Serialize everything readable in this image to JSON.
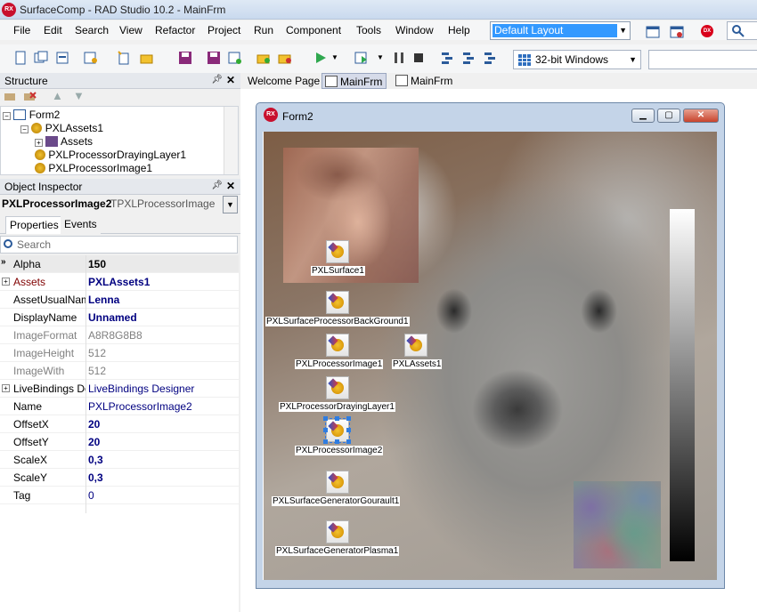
{
  "window": {
    "title": "SurfaceComp - RAD Studio 10.2 - MainFrm",
    "app_icon": "RX"
  },
  "menu": [
    "File",
    "Edit",
    "Search",
    "View",
    "Refactor",
    "Project",
    "Run",
    "Component",
    "Tools",
    "Window",
    "Help"
  ],
  "layout_combo": {
    "value": "Default Layout"
  },
  "platform_combo": {
    "value": "32-bit Windows"
  },
  "dx_badge": "DX",
  "structure": {
    "title": "Structure",
    "tree": [
      {
        "label": "Form2"
      },
      {
        "label": "PXLAssets1"
      },
      {
        "label": "Assets"
      },
      {
        "label": "PXLProcessorDrayingLayer1"
      },
      {
        "label": "PXLProcessorImage1"
      }
    ]
  },
  "object_inspector": {
    "title": "Object Inspector",
    "component_name": "PXLProcessorImage2",
    "component_type": "TPXLProcessorImage",
    "tabs": [
      "Properties",
      "Events"
    ],
    "search_placeholder": "Search",
    "properties": [
      {
        "name": "Alpha",
        "value": "150",
        "name_color": "#000000",
        "value_color": "#000000",
        "bold": true,
        "selected": true,
        "expander": ""
      },
      {
        "name": "Assets",
        "value": "PXLAssets1",
        "name_color": "#800000",
        "value_color": "#000080",
        "bold": true,
        "selected": false,
        "expander": "+"
      },
      {
        "name": "AssetUsualName",
        "value": "Lenna",
        "name_color": "#000000",
        "value_color": "#000080",
        "bold": true,
        "selected": false,
        "expander": ""
      },
      {
        "name": "DisplayName",
        "value": "Unnamed",
        "name_color": "#000000",
        "value_color": "#000080",
        "bold": true,
        "selected": false,
        "expander": ""
      },
      {
        "name": "ImageFormat",
        "value": "A8R8G8B8",
        "name_color": "#808080",
        "value_color": "#808080",
        "bold": false,
        "selected": false,
        "expander": ""
      },
      {
        "name": "ImageHeight",
        "value": "512",
        "name_color": "#808080",
        "value_color": "#808080",
        "bold": false,
        "selected": false,
        "expander": ""
      },
      {
        "name": "ImageWith",
        "value": "512",
        "name_color": "#808080",
        "value_color": "#808080",
        "bold": false,
        "selected": false,
        "expander": ""
      },
      {
        "name": "LiveBindings Designer",
        "value": "LiveBindings Designer",
        "name_color": "#000000",
        "value_color": "#000080",
        "bold": false,
        "selected": false,
        "expander": "+"
      },
      {
        "name": "Name",
        "value": "PXLProcessorImage2",
        "name_color": "#000000",
        "value_color": "#000080",
        "bold": false,
        "selected": false,
        "expander": ""
      },
      {
        "name": "OffsetX",
        "value": "20",
        "name_color": "#000000",
        "value_color": "#000080",
        "bold": true,
        "selected": false,
        "expander": ""
      },
      {
        "name": "OffsetY",
        "value": "20",
        "name_color": "#000000",
        "value_color": "#000080",
        "bold": true,
        "selected": false,
        "expander": ""
      },
      {
        "name": "ScaleX",
        "value": "0,3",
        "name_color": "#000000",
        "value_color": "#000080",
        "bold": true,
        "selected": false,
        "expander": ""
      },
      {
        "name": "ScaleY",
        "value": "0,3",
        "name_color": "#000000",
        "value_color": "#000080",
        "bold": true,
        "selected": false,
        "expander": ""
      },
      {
        "name": "Tag",
        "value": "0",
        "name_color": "#000000",
        "value_color": "#000080",
        "bold": false,
        "selected": false,
        "expander": ""
      }
    ]
  },
  "doc_tabs": [
    "Welcome Page",
    "MainFrm",
    "MainFrm"
  ],
  "form": {
    "title": "Form2",
    "icon": "RX",
    "components": [
      {
        "label": "PXLSurface1"
      },
      {
        "label": "PXLSurfaceProcessorBackGround1"
      },
      {
        "label": "PXLProcessorImage1"
      },
      {
        "label": "PXLAssets1"
      },
      {
        "label": "PXLProcessorDrayingLayer1"
      },
      {
        "label": "PXLProcessorImage2"
      },
      {
        "label": "PXLSurfaceGeneratorGourault1"
      },
      {
        "label": "PXLSurfaceGeneratorPlasma1"
      }
    ]
  }
}
